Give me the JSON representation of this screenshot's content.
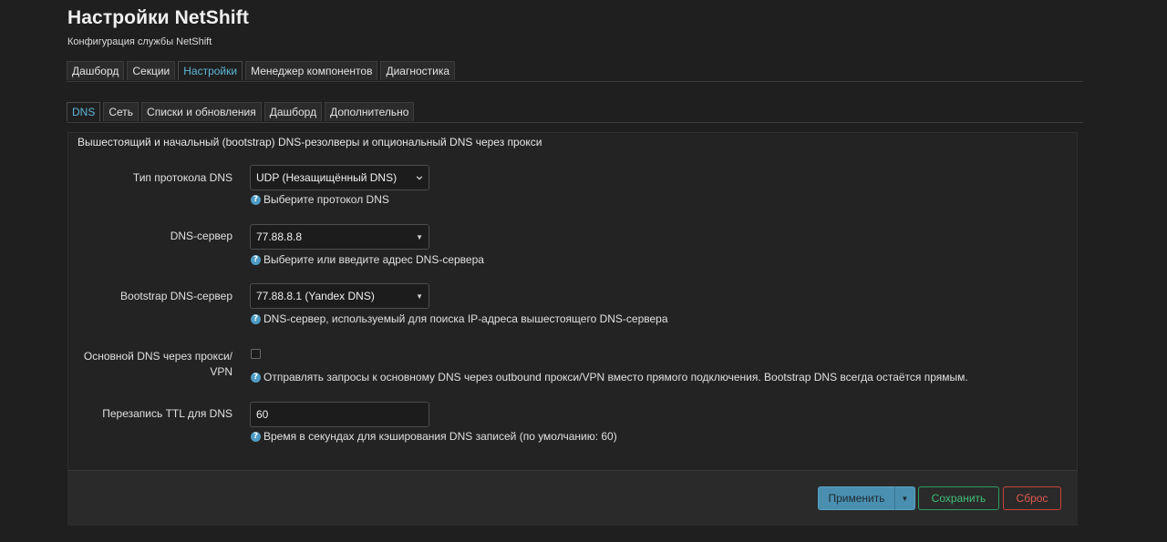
{
  "header": {
    "title": "Настройки NetShift",
    "subtitle": "Конфигурация службы NetShift"
  },
  "main_tabs": [
    {
      "label": "Дашборд",
      "active": false
    },
    {
      "label": "Секции",
      "active": false
    },
    {
      "label": "Настройки",
      "active": true
    },
    {
      "label": "Менеджер компонентов",
      "active": false
    },
    {
      "label": "Диагностика",
      "active": false
    }
  ],
  "sub_tabs": [
    {
      "label": "DNS",
      "active": true
    },
    {
      "label": "Сеть",
      "active": false
    },
    {
      "label": "Списки и обновления",
      "active": false
    },
    {
      "label": "Дашборд",
      "active": false
    },
    {
      "label": "Дополнительно",
      "active": false
    }
  ],
  "section": {
    "description": "Вышестоящий и начальный (bootstrap) DNS-резолверы и опциональный DNS через прокси",
    "fields": {
      "dns_protocol": {
        "label": "Тип протокола DNS",
        "value": "UDP (Незащищённый DNS)",
        "help": "Выберите протокол DNS"
      },
      "dns_server": {
        "label": "DNS-сервер",
        "value": "77.88.8.8",
        "help": "Выберите или введите адрес DNS-сервера"
      },
      "bootstrap_dns": {
        "label": "Bootstrap DNS-сервер",
        "value": "77.88.8.1 (Yandex DNS)",
        "help": "DNS-сервер, используемый для поиска IP-адреса вышестоящего DNS-сервера"
      },
      "dns_via_proxy": {
        "label_line1": "Основной DNS через прокси/",
        "label_line2": "VPN",
        "checked": false,
        "help": "Отправлять запросы к основному DNS через outbound прокси/VPN вместо прямого подключения. Bootstrap DNS всегда остаётся прямым."
      },
      "ttl_rewrite": {
        "label": "Перезапись TTL для DNS",
        "value": "60",
        "help": "Время в секундах для кэширования DNS записей (по умолчанию: 60)"
      }
    }
  },
  "footer": {
    "apply_label": "Применить",
    "save_label": "Сохранить",
    "reset_label": "Сброс"
  },
  "icons": {
    "help": "help-circle-icon",
    "select": "chevron-down-icon",
    "combo": "caret-down-icon"
  },
  "colors": {
    "accent": "#5fb7d6",
    "apply": "#4a8fb0",
    "save": "#3fbf7a",
    "reset": "#e35a4f",
    "help_icon": "#4f9bc4"
  }
}
